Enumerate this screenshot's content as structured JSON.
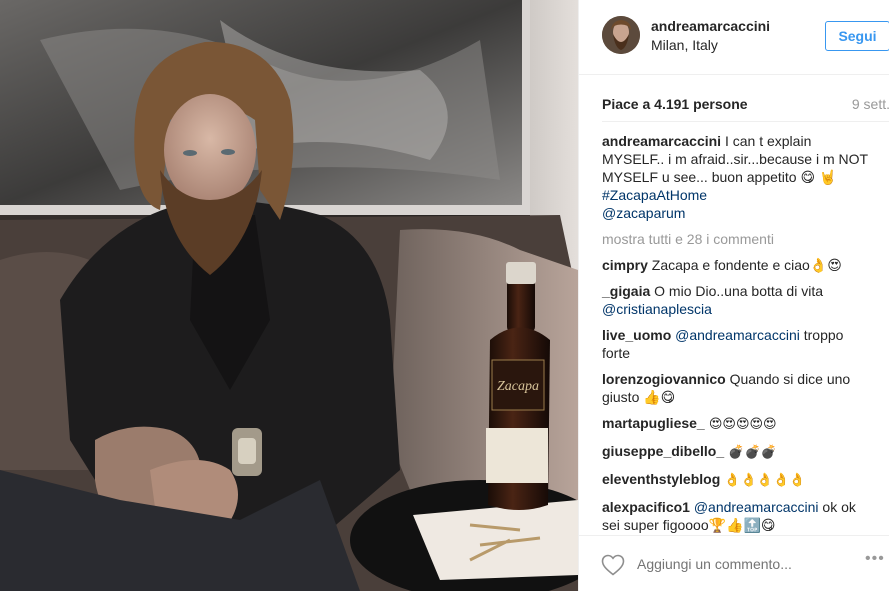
{
  "post": {
    "username": "andreamarcaccini",
    "location": "Milan, Italy",
    "follow_label": "Segui",
    "likes": "Piace a 4.191 persone",
    "age": "9 sett.",
    "more_comments": "mostra tutti e 28 i commenti",
    "add_comment_placeholder": "Aggiungi un commento...",
    "options_label": "•••"
  },
  "caption": {
    "user": "andreamarcaccini",
    "text": " I can t explain MYSELF.. i m afraid..sir...because i m NOT MYSELF u see... buon appetito 😋 🤘",
    "hashtag": "#ZacapaAtHome",
    "mention": "@zacaparum"
  },
  "comments": [
    {
      "user": "cimpry",
      "text": " Zacapa e fondente e ciao👌😍",
      "mention": ""
    },
    {
      "user": "_gigaia",
      "text": " O mio Dio..una botta di vita",
      "mention": "@cristianaplescia"
    },
    {
      "user": "live_uomo",
      "text": " troppo forte",
      "mention": "@andreamarcaccini"
    },
    {
      "user": "lorenzogiovannico",
      "text": " Quando si dice uno giusto 👍😋",
      "mention": ""
    },
    {
      "user": "martapugliese_",
      "text": " 😍😍😍😍😍",
      "mention": ""
    },
    {
      "user": "giuseppe_dibello_",
      "text": " 💣💣💣",
      "mention": ""
    },
    {
      "user": "eleventhstyleblog",
      "text": " 👌👌👌👌👌",
      "mention": ""
    },
    {
      "user": "alexpacifico1",
      "text": " ok ok sei super figoooo🏆👍🔝😋",
      "mention": "@andreamarcaccini"
    }
  ],
  "bottle_label": "Zacapa",
  "colors": {
    "accent": "#3897f0",
    "link": "#003569",
    "muted": "#999999",
    "border": "#efefef"
  },
  "icons": [
    "heart-icon",
    "options-icon"
  ]
}
